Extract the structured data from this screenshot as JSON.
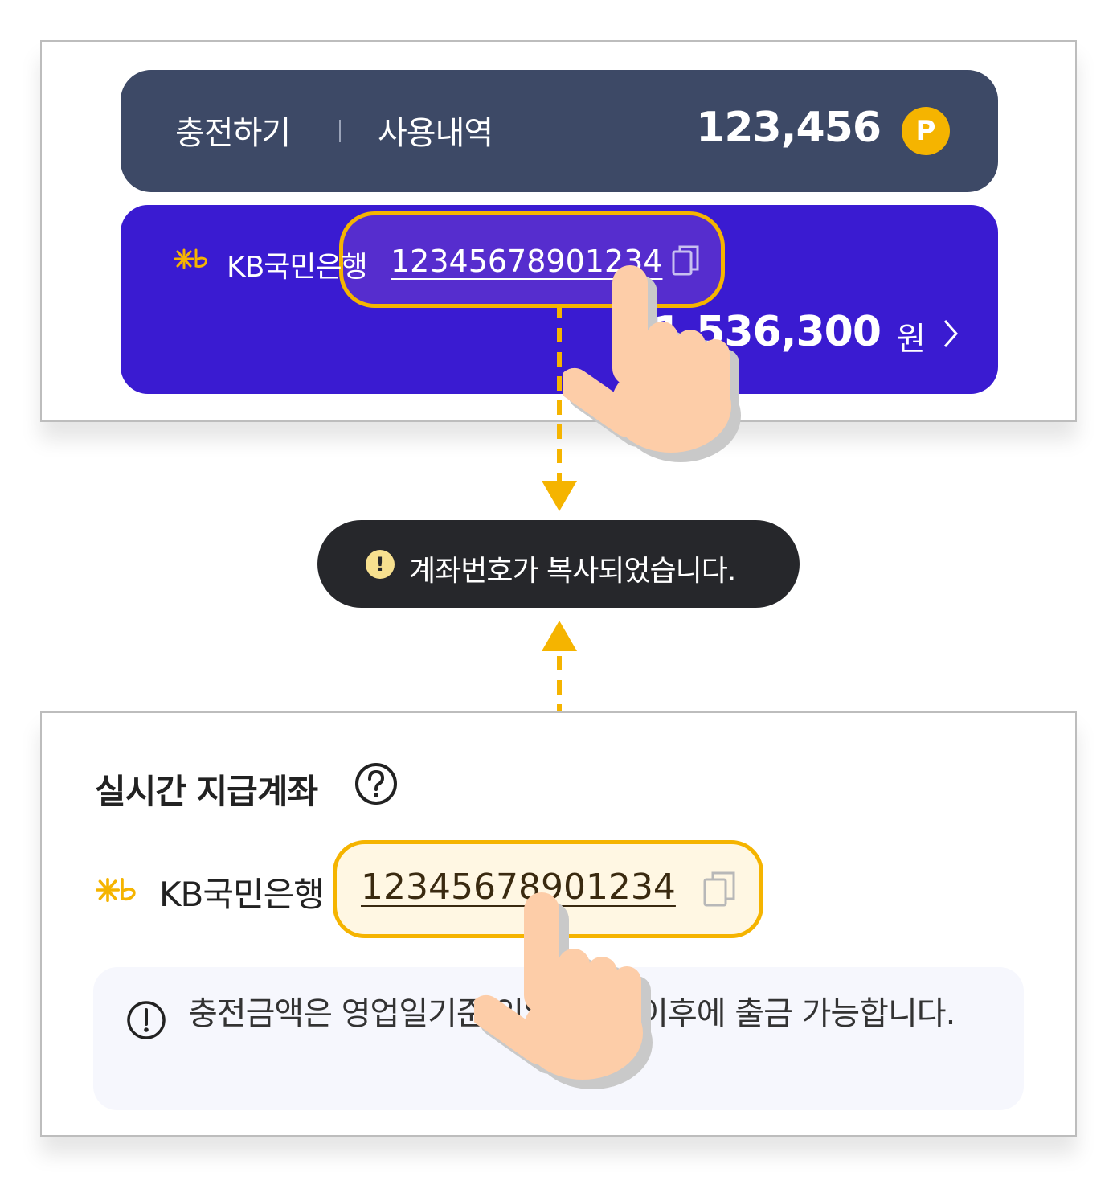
{
  "top_panel": {
    "tab_charge": "충전하기",
    "tab_history": "사용내역",
    "points": "123,456",
    "point_badge": "P",
    "bank_name": "KB국민은행",
    "account_number": "12345678901234",
    "balance": "1,536,300",
    "currency": "원"
  },
  "toast": {
    "icon_label": "!",
    "message": "계좌번호가 복사되었습니다."
  },
  "bottom_panel": {
    "title": "실시간 지급계좌",
    "bank_name": "KB국민은행",
    "account_number": "12345678901234",
    "notice": "충전금액은 영업일기준 익일 10시 이후에 출금 가능합니다."
  },
  "colors": {
    "point_bar": "#3d4966",
    "bank_card": "#3a1bd1",
    "highlight": "#f5b400",
    "toast_bg": "#26272b",
    "hand": "#fdcda8"
  },
  "icons": [
    "kb-logo-icon",
    "copy-icon",
    "chevron-right-icon",
    "help-icon",
    "info-icon",
    "pointer-hand-icon",
    "alert-icon"
  ]
}
